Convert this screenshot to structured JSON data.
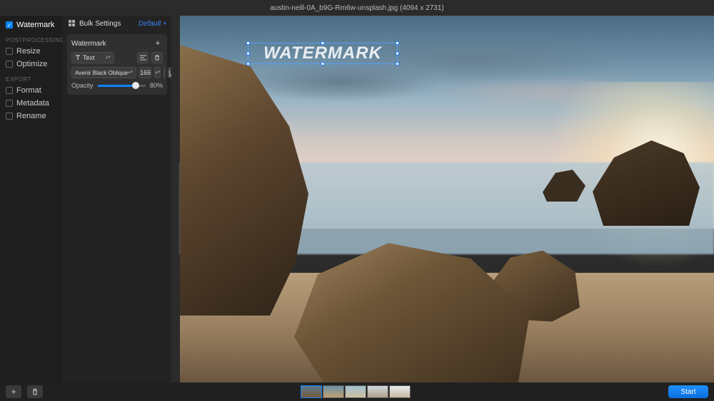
{
  "file": {
    "name": "austin-neill-0A_b9G-Rm6w-unsplash.jpg",
    "dims": "(4094 x 2731)"
  },
  "sidebar": {
    "items": [
      {
        "label": "Watermark",
        "checked": true,
        "active": true
      },
      {
        "section": "POSTPROCESSING"
      },
      {
        "label": "Resize",
        "checked": false
      },
      {
        "label": "Optimize",
        "checked": false
      },
      {
        "section": "EXPORT"
      },
      {
        "label": "Format",
        "checked": false
      },
      {
        "label": "Metadata",
        "checked": false
      },
      {
        "label": "Rename",
        "checked": false
      }
    ]
  },
  "settings": {
    "bulk_label": "Bulk Settings",
    "preset_label": "Default",
    "panel_title": "Watermark",
    "type_label": "Text",
    "font_label": "Avenir Black Oblique",
    "size_value": "166",
    "underline_label": "U",
    "opacity_label": "Opacity",
    "opacity_value": "80%",
    "opacity_pct": 80,
    "color_hex": "#ffffff"
  },
  "watermark": {
    "text": "WATERMARK"
  },
  "thumbs": [
    {
      "bg": "linear-gradient(180deg,#5a7a90,#7a5a3a)",
      "selected": true
    },
    {
      "bg": "linear-gradient(180deg,#6a92a8,#c0a070)",
      "selected": false
    },
    {
      "bg": "linear-gradient(180deg,#a0c0d0,#d0c0a0)",
      "selected": false
    },
    {
      "bg": "linear-gradient(180deg,#d0d8e0,#b0a088)",
      "selected": false
    },
    {
      "bg": "linear-gradient(180deg,#e8ecf0,#c8b8a0)",
      "selected": false
    }
  ],
  "bottom": {
    "start_label": "Start"
  }
}
